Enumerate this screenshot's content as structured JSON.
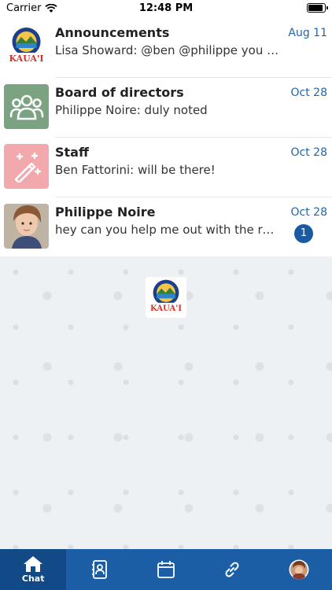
{
  "status": {
    "carrier": "Carrier",
    "time": "12:48 PM",
    "battery_level": 0.95
  },
  "chats": [
    {
      "title": "Announcements",
      "preview": "Lisa Showard: @ben @philippe you are …",
      "date": "Aug 11",
      "avatar": "rotary-club-logo"
    },
    {
      "title": "Board of directors",
      "preview": "Philippe Noire: duly noted",
      "date": "Oct 28",
      "avatar": "group-icon"
    },
    {
      "title": "Staff",
      "preview": "Ben Fattorini: will be there!",
      "date": "Oct 28",
      "avatar": "magic-wand-icon"
    },
    {
      "title": "Philippe Noire",
      "preview": "hey can you help me out with the repo…",
      "date": "Oct 28",
      "unread": "1",
      "avatar": "profile-photo"
    }
  ],
  "tabs": [
    {
      "label": "Chat",
      "icon": "home-icon",
      "active": true
    },
    {
      "label": "",
      "icon": "contacts-icon"
    },
    {
      "label": "",
      "icon": "calendar-icon"
    },
    {
      "label": "",
      "icon": "link-icon"
    },
    {
      "label": "",
      "icon": "profile-avatar-icon"
    }
  ],
  "colors": {
    "accent": "#1c5ea6",
    "date": "#2466a6",
    "board_avatar": "#7ba382",
    "staff_avatar": "#f2a9ae"
  }
}
